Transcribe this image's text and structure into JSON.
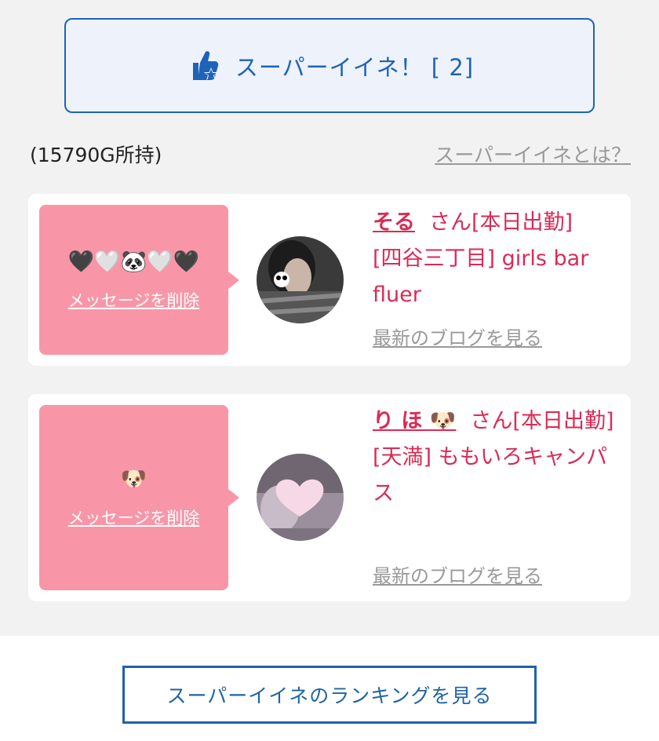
{
  "super_button": {
    "label": "スーパーイイネ！ [ 2]"
  },
  "owned_text": "(15790G所持)",
  "what_is_link": "スーパーイイネとは？",
  "cards": [
    {
      "message": "🖤🤍🐼🤍🖤",
      "delete_label": "メッセージを削除",
      "name": "そる",
      "suffix": "さん[本日出勤]",
      "shop": "[四谷三丁目] girls bar fluer",
      "blog_label": "最新のブログを見る"
    },
    {
      "message": "🐶",
      "delete_label": "メッセージを削除",
      "name": "り ほ 🐶",
      "suffix": "さん[本日出勤]",
      "shop": "[天満] ももいろキャンパス",
      "blog_label": "最新のブログを見る"
    }
  ],
  "ranking_button": "スーパーイイネのランキングを見る",
  "colors": {
    "accent": "#1e63b8",
    "pink": "#f896a8",
    "name_red": "#d92b55"
  }
}
